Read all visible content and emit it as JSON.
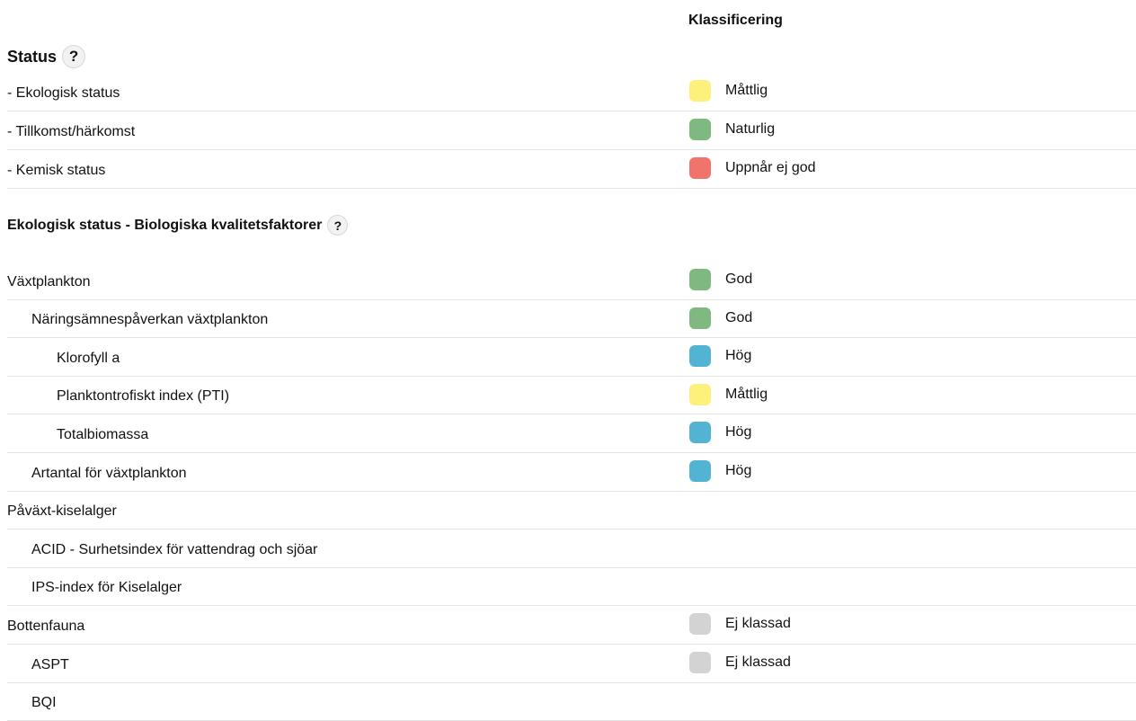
{
  "header": {
    "classification": "Klassificering"
  },
  "status_section": {
    "title": "Status",
    "help": "?",
    "rows": [
      {
        "label": "- Ekologisk status",
        "classification": "Måttlig",
        "color": "#fdf17c"
      },
      {
        "label": "- Tillkomst/härkomst",
        "classification": "Naturlig",
        "color": "#80b882"
      },
      {
        "label": "- Kemisk status",
        "classification": "Uppnår ej god",
        "color": "#f0736c"
      }
    ]
  },
  "bio_section": {
    "title": "Ekologisk status - Biologiska kvalitetsfaktorer",
    "help": "?",
    "rows": [
      {
        "label": "Växtplankton",
        "level": 0,
        "classification": "God",
        "color": "#80b882"
      },
      {
        "label": "Näringsämnespåverkan växtplankton",
        "level": 1,
        "classification": "God",
        "color": "#80b882"
      },
      {
        "label": "Klorofyll a",
        "level": 2,
        "classification": "Hög",
        "color": "#52b3d2"
      },
      {
        "label": "Planktontrofiskt index (PTI)",
        "level": 2,
        "classification": "Måttlig",
        "color": "#fdf17c"
      },
      {
        "label": "Totalbiomassa",
        "level": 2,
        "classification": "Hög",
        "color": "#52b3d2"
      },
      {
        "label": "Artantal för växtplankton",
        "level": 1,
        "classification": "Hög",
        "color": "#52b3d2"
      },
      {
        "label": "Påväxt-kiselalger",
        "level": 0,
        "classification": "",
        "color": ""
      },
      {
        "label": "ACID - Surhetsindex för vattendrag och sjöar",
        "level": 1,
        "classification": "",
        "color": ""
      },
      {
        "label": "IPS-index för Kiselalger",
        "level": 1,
        "classification": "",
        "color": ""
      },
      {
        "label": "Bottenfauna",
        "level": 0,
        "classification": "Ej klassad",
        "color": "#d3d3d3"
      },
      {
        "label": "ASPT",
        "level": 1,
        "classification": "Ej klassad",
        "color": "#d3d3d3"
      },
      {
        "label": "BQI",
        "level": 1,
        "classification": "",
        "color": ""
      }
    ]
  }
}
